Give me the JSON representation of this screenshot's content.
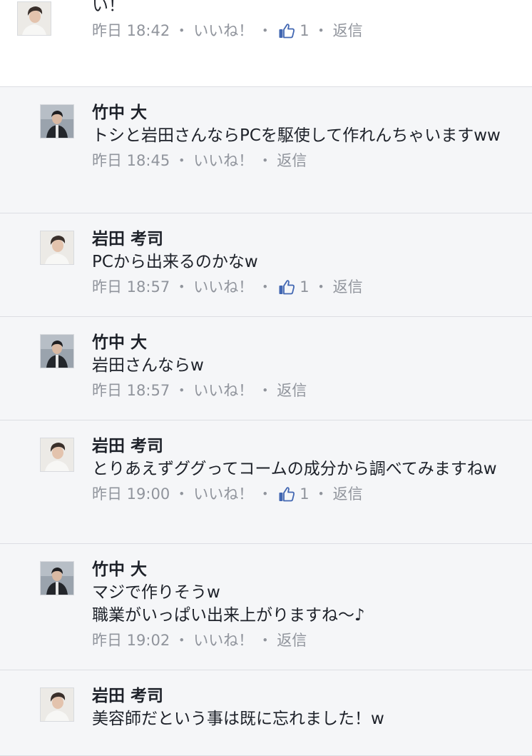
{
  "comments": [
    {
      "type": "top",
      "author": "",
      "text": "これマジで凹みますよね。releaseさんで作ってください！",
      "time": "昨日 18:42",
      "like_label": "いいね！",
      "like_count": "1",
      "reply_label": "返信",
      "avatar_icon": "profile-photo-man-white-shirt"
    },
    {
      "type": "reply",
      "author": "竹中 大",
      "text": "トシと岩田さんならPCを駆使して作れんちゃいますww",
      "time": "昨日 18:45",
      "like_label": "いいね！",
      "like_count": "",
      "reply_label": "返信",
      "avatar_icon": "profile-photo-man-dark-jacket"
    },
    {
      "type": "reply",
      "author": "岩田 考司",
      "text": "PCから出来るのかなw",
      "time": "昨日 18:57",
      "like_label": "いいね！",
      "like_count": "1",
      "reply_label": "返信",
      "avatar_icon": "profile-photo-man-white-shirt"
    },
    {
      "type": "reply",
      "author": "竹中 大",
      "text": "岩田さんならw",
      "time": "昨日 18:57",
      "like_label": "いいね！",
      "like_count": "",
      "reply_label": "返信",
      "avatar_icon": "profile-photo-man-dark-jacket"
    },
    {
      "type": "reply",
      "author": "岩田 考司",
      "text": "とりあえずググってコームの成分から調べてみますねw",
      "time": "昨日 19:00",
      "like_label": "いいね！",
      "like_count": "1",
      "reply_label": "返信",
      "avatar_icon": "profile-photo-man-white-shirt"
    },
    {
      "type": "reply",
      "author": "竹中 大",
      "text": "マジで作りそうw\n職業がいっぱい出来上がりますね〜♪",
      "time": "昨日 19:02",
      "like_label": "いいね！",
      "like_count": "",
      "reply_label": "返信",
      "avatar_icon": "profile-photo-man-dark-jacket"
    },
    {
      "type": "reply",
      "author": "岩田 考司",
      "text": "美容師だという事は既に忘れました！w",
      "time": "",
      "like_label": "",
      "like_count": "",
      "reply_label": "",
      "avatar_icon": "profile-photo-man-white-shirt"
    }
  ],
  "separator": "・",
  "colors": {
    "page_background": "#f5f6f8",
    "top_comment_background": "#ffffff",
    "text": "#1d2129",
    "meta_text": "#90949c",
    "divider": "#dcdee3",
    "like_icon": "#4267b2"
  }
}
